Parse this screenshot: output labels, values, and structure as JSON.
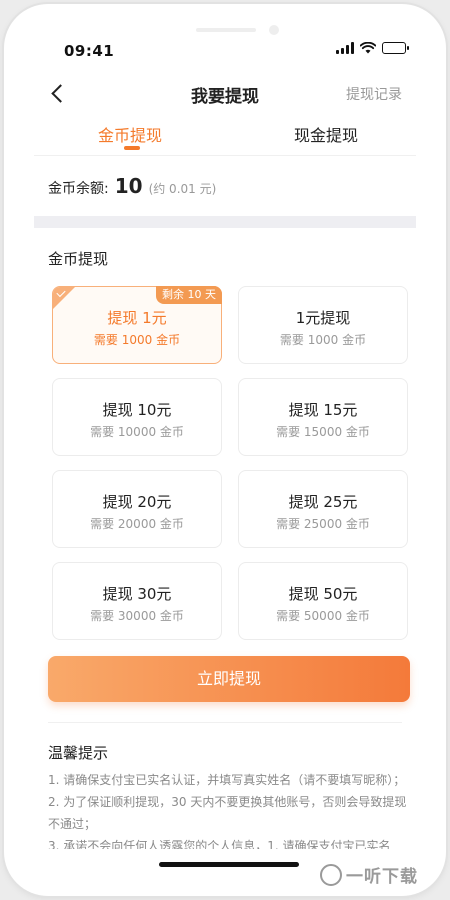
{
  "status": {
    "time": "09:41",
    "icons": [
      "signal-icon",
      "wifi-icon",
      "battery-icon"
    ]
  },
  "nav": {
    "title": "我要提现",
    "right_label": "提现记录"
  },
  "tabs": [
    {
      "label": "金币提现",
      "active": true
    },
    {
      "label": "现金提现",
      "active": false
    }
  ],
  "balance": {
    "label": "金币余额:",
    "value": "10",
    "note": "(约 0.01 元)"
  },
  "section": {
    "title": "金币提现"
  },
  "options": [
    {
      "title": "提现 1元",
      "sub": "需要 1000 金币",
      "selected": true,
      "badge": "剩余 10 天"
    },
    {
      "title": "1元提现",
      "sub": "需要 1000 金币"
    },
    {
      "title": "提现 10元",
      "sub": "需要 10000 金币"
    },
    {
      "title": "提现 15元",
      "sub": "需要 15000 金币"
    },
    {
      "title": "提现 20元",
      "sub": "需要 20000 金币"
    },
    {
      "title": "提现 25元",
      "sub": "需要 25000 金币"
    },
    {
      "title": "提现 30元",
      "sub": "需要 30000 金币"
    },
    {
      "title": "提现 50元",
      "sub": "需要 50000 金币"
    }
  ],
  "cta": {
    "label": "立即提现"
  },
  "tips": {
    "title": "温馨提示",
    "items": [
      "1. 请确保支付宝已实名认证，并填写真实姓名（请不要填写昵称）；",
      "2. 为了保证顺利提现，30 天内不要更换其他账号，否则会导致提现不通过；",
      "3. 承诺不会向任何人透露您的个人信息，1. 请确保支付宝已实名"
    ]
  },
  "watermark": {
    "text": "一听下载"
  },
  "colors": {
    "accent": "#f47a2b",
    "badge": "#f39a52",
    "cta_start": "#f9a96a",
    "cta_end": "#f47a3a"
  }
}
